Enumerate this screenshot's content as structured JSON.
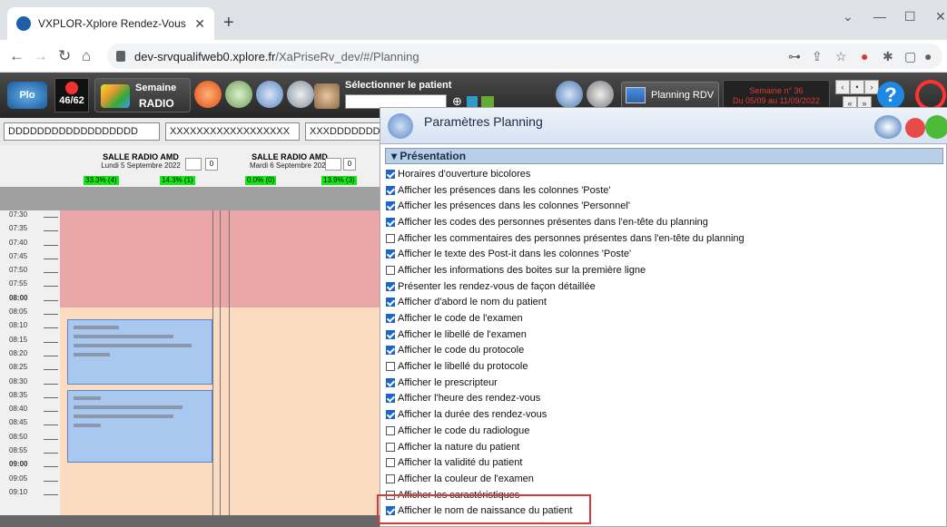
{
  "browser": {
    "tab_title": "VXPLOR-Xplore Rendez-Vous",
    "url_host": "dev-srvqualifweb0.xplore.fr",
    "url_path": "/XaPriseRv_dev/#/Planning"
  },
  "app_toolbar": {
    "logo": "Plo",
    "counter": "46/62",
    "modality_line1": "Semaine",
    "modality_line2": "RADIO",
    "select_patient_label": "Sélectionner le patient",
    "planning_rdv_label": "Planning RDV",
    "week_label": "Semaine n° 36",
    "week_range": "Du 05/09 au 11/09/2022"
  },
  "resources": [
    "DDDDDDDDDDDDDDDDDD",
    "XXXXXXXXXXXXXXXXXX",
    "XXXDDDDDDDD"
  ],
  "calendar": {
    "columns": [
      {
        "name": "SALLE RADIO AMD",
        "date": "Lundi 5 Septembre 2022",
        "count": "0",
        "pct_left": "33.3% (4)",
        "pct_right": "14.3% (1)"
      },
      {
        "name": "SALLE RADIO AMD",
        "date": "Mardi 6 Septembre 2022",
        "count": "0",
        "pct_left": "0.0% (0)",
        "pct_right": "13.9% (3)"
      }
    ],
    "times": [
      "07:30",
      "07:35",
      "07:40",
      "07:45",
      "07:50",
      "07:55",
      "08:00",
      "08:05",
      "08:10",
      "08:15",
      "08:20",
      "08:25",
      "08:30",
      "08:35",
      "08:40",
      "08:45",
      "08:50",
      "08:55",
      "09:00",
      "09:05",
      "09:10"
    ]
  },
  "panel": {
    "title": "Paramètres Planning",
    "section": "Présentation",
    "options": [
      {
        "label": "Horaires d'ouverture bicolores",
        "checked": true
      },
      {
        "label": "Afficher les présences dans les colonnes 'Poste'",
        "checked": true
      },
      {
        "label": "Afficher les présences dans les colonnes 'Personnel'",
        "checked": true
      },
      {
        "label": "Afficher les codes des personnes présentes dans l'en-tête du planning",
        "checked": true
      },
      {
        "label": "Afficher les commentaires des personnes présentes dans l'en-tête du planning",
        "checked": false
      },
      {
        "label": "Afficher le texte des Post-it dans les colonnes 'Poste'",
        "checked": true
      },
      {
        "label": "Afficher les informations des boites sur la première ligne",
        "checked": false
      },
      {
        "label": "Présenter les rendez-vous de façon détaillée",
        "checked": true
      },
      {
        "label": "Afficher d'abord le nom du patient",
        "checked": true
      },
      {
        "label": "Afficher le code de l'examen",
        "checked": true
      },
      {
        "label": "Afficher le libellé de l'examen",
        "checked": true
      },
      {
        "label": "Afficher le code du protocole",
        "checked": true
      },
      {
        "label": "Afficher le libellé du protocole",
        "checked": false
      },
      {
        "label": "Afficher le prescripteur",
        "checked": true
      },
      {
        "label": "Afficher l'heure des rendez-vous",
        "checked": true
      },
      {
        "label": "Afficher la durée des rendez-vous",
        "checked": true
      },
      {
        "label": "Afficher le code du radiologue",
        "checked": false
      },
      {
        "label": "Afficher la nature du patient",
        "checked": false
      },
      {
        "label": "Afficher la validité du patient",
        "checked": false
      },
      {
        "label": "Afficher la couleur de l'examen",
        "checked": false
      },
      {
        "label": "Afficher les caractéristiques",
        "checked": false
      },
      {
        "label": "Afficher le nom de naissance du patient",
        "checked": true
      }
    ]
  }
}
